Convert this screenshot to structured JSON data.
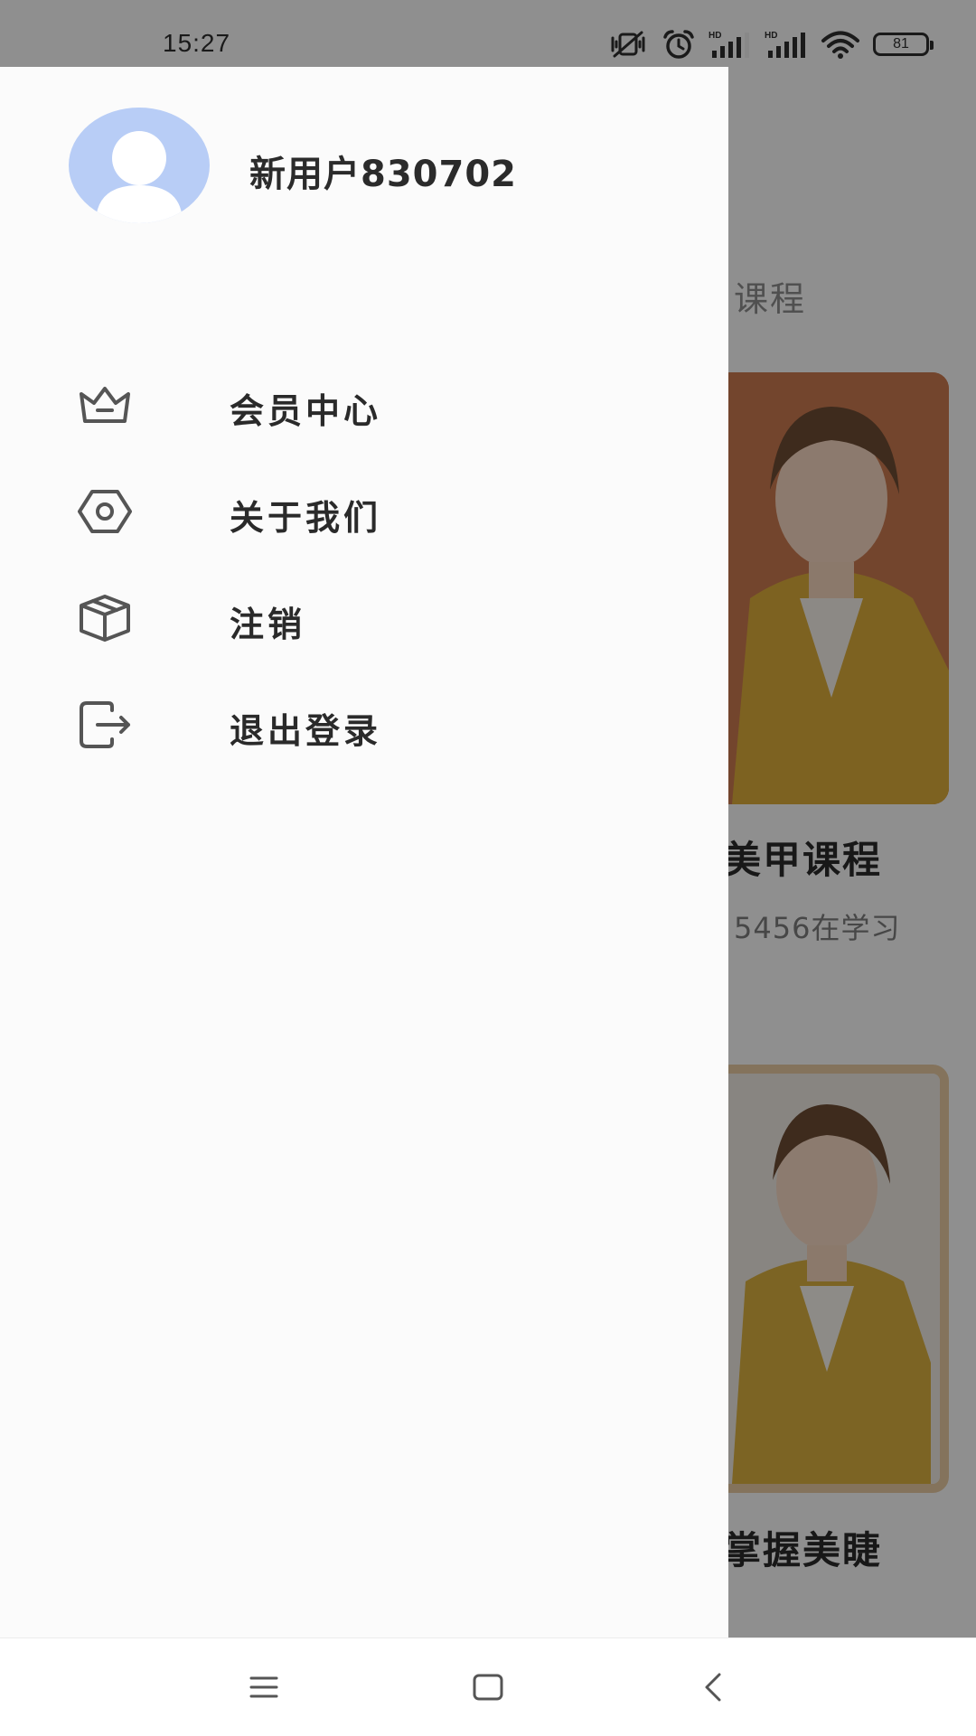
{
  "status_bar": {
    "time": "15:27",
    "icons": [
      "mute-vibrate-icon",
      "alarm-icon",
      "hd-signal-icon",
      "hd-signal-icon",
      "wifi-icon",
      "battery-icon"
    ],
    "signal_badge": "HD",
    "battery_level": "81"
  },
  "drawer": {
    "username": "新用户830702",
    "avatar": "default-avatar",
    "menu": [
      {
        "label": "会员中心",
        "icon": "crown-icon"
      },
      {
        "label": "关于我们",
        "icon": "hexagon-eye-icon"
      },
      {
        "label": "注销",
        "icon": "box-icon"
      },
      {
        "label": "退出登录",
        "icon": "logout-icon"
      }
    ]
  },
  "background_page": {
    "tab_label": "课程",
    "cards": [
      {
        "title": "美甲课程",
        "learners": "5456在学习"
      },
      {
        "title": "掌握美睫"
      }
    ]
  },
  "nav_bar": {
    "buttons": [
      "menu-icon",
      "home-icon",
      "back-icon"
    ]
  },
  "colors": {
    "drawer_bg": "#fbfbfb",
    "avatar_bg": "#b8cdf6",
    "scrim": "rgba(0,0,0,0.42)",
    "text_primary": "#2a2a2a"
  }
}
